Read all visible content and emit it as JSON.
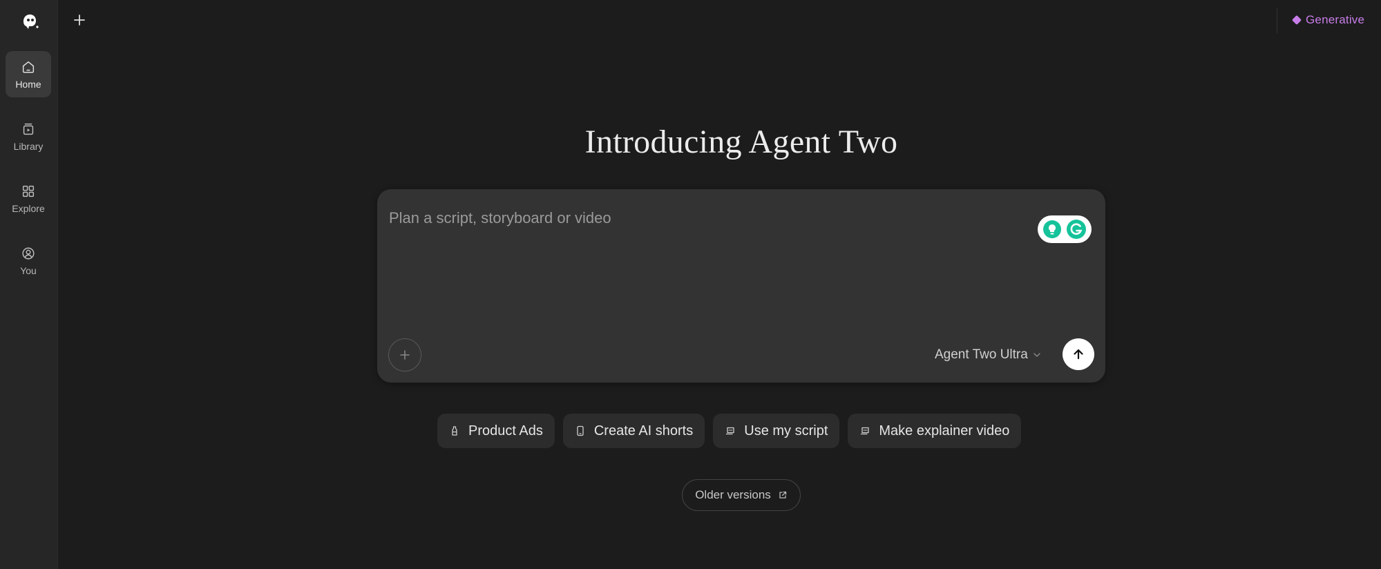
{
  "sidebar": {
    "items": [
      {
        "label": "Home",
        "icon": "home-icon",
        "active": true
      },
      {
        "label": "Library",
        "icon": "library-icon",
        "active": false
      },
      {
        "label": "Explore",
        "icon": "explore-icon",
        "active": false
      },
      {
        "label": "You",
        "icon": "user-icon",
        "active": false
      }
    ]
  },
  "topbar": {
    "new_icon": "plus-icon",
    "plan_label": "Generative",
    "plan_color": "#c77de8"
  },
  "main": {
    "headline": "Introducing Agent Two",
    "prompt": {
      "placeholder": "Plan a script, storyboard or video",
      "model": "Agent Two Ultra"
    },
    "chips": [
      {
        "label": "Product Ads",
        "icon": "bottle-icon"
      },
      {
        "label": "Create AI shorts",
        "icon": "phone-icon"
      },
      {
        "label": "Use my script",
        "icon": "script-icon"
      },
      {
        "label": "Make explainer video",
        "icon": "script-icon"
      }
    ],
    "older_versions": "Older versions"
  }
}
